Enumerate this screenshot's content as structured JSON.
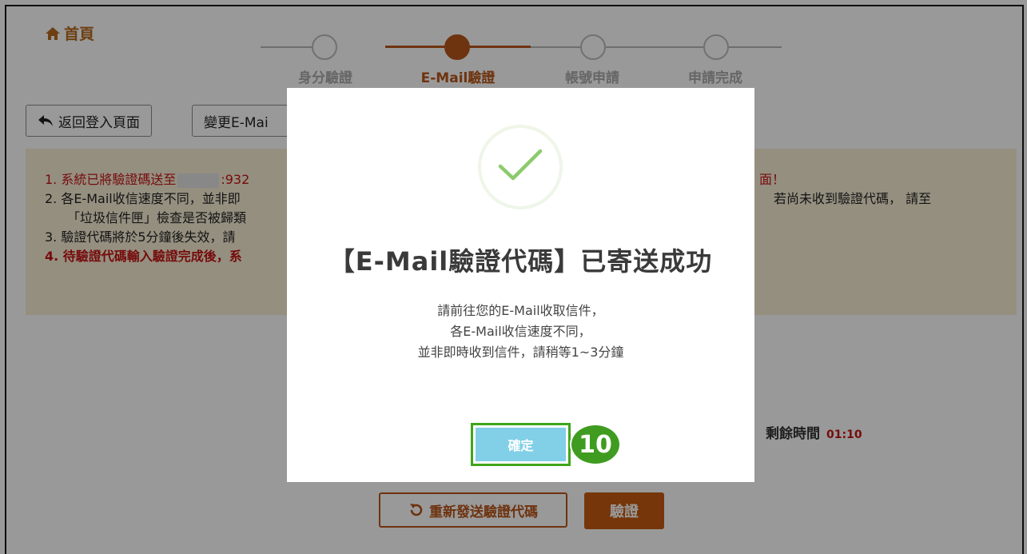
{
  "nav": {
    "home_label": "首頁"
  },
  "steps": [
    {
      "label": "身分驗證",
      "active": false
    },
    {
      "label": "E-Mail驗證",
      "active": true
    },
    {
      "label": "帳號申請",
      "active": false
    },
    {
      "label": "申請完成",
      "active": false
    }
  ],
  "toolbar": {
    "back_label": "返回登入頁面",
    "change_email_label": "變更E-Mai"
  },
  "notice": {
    "line1_left": "1. 系統已將驗證碼送至",
    "line1_mid": ":932",
    "line1_right": "面！",
    "line2_left": "2. 各E-Mail收信速度不同，並非即",
    "line2_right": "若尚未收到驗證代碼， 請至",
    "line2b": "「垃圾信件匣」檢查是否被歸類",
    "line3": "3. 驗證代碼將於5分鐘後失效，請",
    "line4": "4. 待驗證代碼輸入驗證完成後，系"
  },
  "timer": {
    "label": "剩餘時間",
    "value": "01:10"
  },
  "actions": {
    "resend_label": "重新發送驗證代碼",
    "verify_label": "驗證"
  },
  "modal": {
    "title": "【E-Mail驗證代碼】已寄送成功",
    "message": [
      "請前往您的E-Mail收取信件，",
      "各E-Mail收信速度不同，",
      "並非即時收到信件，請稍等1~3分鐘"
    ],
    "confirm_label": "確定"
  },
  "annotation": {
    "step_number": "10"
  },
  "colors": {
    "accent": "#b8561a",
    "confirm": "#82cfe8",
    "highlight": "#3fa61a",
    "warning_text": "#c41414",
    "notice_bg": "#f8efd6"
  }
}
